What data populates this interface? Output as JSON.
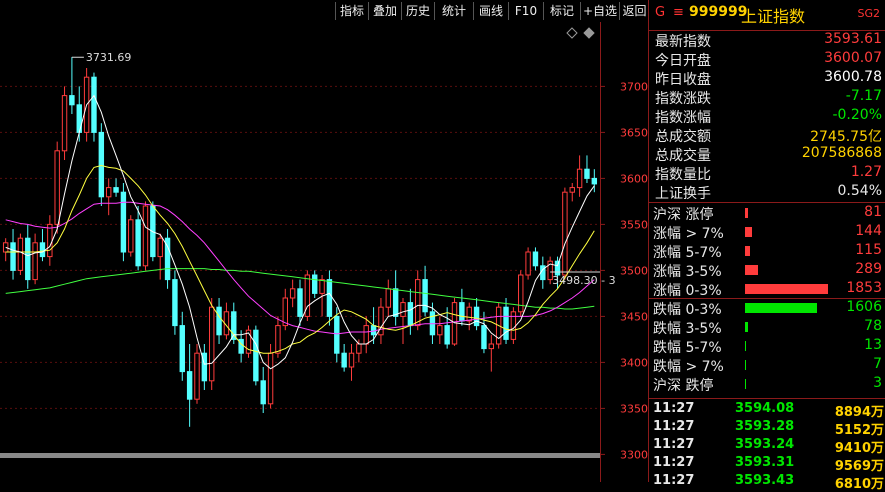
{
  "toolbar": {
    "buttons": [
      "指标",
      "叠加",
      "历史",
      "统计",
      "画线",
      "F10",
      "标记",
      "+自选",
      "返回"
    ]
  },
  "header": {
    "g_label": "G",
    "eq_label": "≡",
    "code": "999999",
    "name": "上证指数",
    "badge": "SG2"
  },
  "quote": [
    {
      "label": "最新指数",
      "value": "3593.61",
      "color": "#ff3c3c"
    },
    {
      "label": "今日开盘",
      "value": "3600.07",
      "color": "#ff3c3c"
    },
    {
      "label": "昨日收盘",
      "value": "3600.78",
      "color": "#ffffff"
    },
    {
      "label": "指数涨跌",
      "value": "-7.17",
      "color": "#00e600"
    },
    {
      "label": "指数涨幅",
      "value": "-0.20%",
      "color": "#00e600"
    },
    {
      "label": "总成交额",
      "value": "2745.75亿",
      "color": "#ffd200"
    },
    {
      "label": "总成交量",
      "value": "207586868",
      "color": "#ffd200"
    },
    {
      "label": "指数量比",
      "value": "1.27",
      "color": "#ff3c3c"
    },
    {
      "label": "上证换手",
      "value": "0.54%",
      "color": "#e8e8e8"
    }
  ],
  "breadth": [
    {
      "label": "沪深 涨停",
      "value": "81",
      "fraction": 0.04,
      "color": "#ff3c3c"
    },
    {
      "label": "涨幅 > 7%",
      "value": "144",
      "fraction": 0.08,
      "color": "#ff3c3c"
    },
    {
      "label": "涨幅 5-7%",
      "value": "115",
      "fraction": 0.06,
      "color": "#ff3c3c"
    },
    {
      "label": "涨幅 3-5%",
      "value": "289",
      "fraction": 0.16,
      "color": "#ff3c3c"
    },
    {
      "label": "涨幅 0-3%",
      "value": "1853",
      "fraction": 1.0,
      "color": "#ff3c3c"
    },
    {
      "label": "跌幅 0-3%",
      "value": "1606",
      "fraction": 0.87,
      "color": "#00e600"
    },
    {
      "label": "跌幅 3-5%",
      "value": "78",
      "fraction": 0.04,
      "color": "#00e600"
    },
    {
      "label": "跌幅 5-7%",
      "value": "13",
      "fraction": 0.01,
      "color": "#00e600"
    },
    {
      "label": "跌幅 > 7%",
      "value": "7",
      "fraction": 0.005,
      "color": "#00e600"
    },
    {
      "label": "沪深 跌停",
      "value": "3",
      "fraction": 0.003,
      "color": "#00e600"
    }
  ],
  "ticks": [
    {
      "time": "11:27",
      "price": "3594.08",
      "vol": "8894万"
    },
    {
      "time": "11:27",
      "price": "3593.28",
      "vol": "5152万"
    },
    {
      "time": "11:27",
      "price": "3593.24",
      "vol": "9410万"
    },
    {
      "time": "11:27",
      "price": "3593.31",
      "vol": "9569万"
    },
    {
      "time": "11:27",
      "price": "3593.43",
      "vol": "6810万"
    }
  ],
  "chart_data": {
    "type": "candlestick",
    "ylim": [
      3270,
      3770
    ],
    "y_ticks": [
      3300,
      3350,
      3400,
      3450,
      3500,
      3550,
      3600,
      3650,
      3700
    ],
    "y_tick_labels": [
      "3300",
      "3350",
      "3400",
      "3450",
      "3500",
      "3550",
      "3600",
      "3650",
      "3700"
    ],
    "max_label": "3731.69",
    "max_value": 3731.69,
    "last_label": "3498.30 - 3",
    "last_value": 3498.3,
    "colors": {
      "up": "#ff3c3c",
      "down": "#54ffff",
      "ma5": "#ffffff",
      "ma10": "#ffff40",
      "ma20": "#ff40ff",
      "ma60": "#40ff40"
    },
    "candles": [
      [
        3520,
        3535,
        3510,
        3530
      ],
      [
        3530,
        3545,
        3490,
        3500
      ],
      [
        3500,
        3540,
        3495,
        3535
      ],
      [
        3535,
        3550,
        3480,
        3490
      ],
      [
        3490,
        3540,
        3485,
        3530
      ],
      [
        3530,
        3545,
        3510,
        3515
      ],
      [
        3515,
        3560,
        3505,
        3550
      ],
      [
        3550,
        3640,
        3540,
        3630
      ],
      [
        3630,
        3700,
        3620,
        3690
      ],
      [
        3690,
        3732,
        3670,
        3680
      ],
      [
        3680,
        3700,
        3640,
        3650
      ],
      [
        3650,
        3720,
        3640,
        3710
      ],
      [
        3710,
        3715,
        3640,
        3650
      ],
      [
        3650,
        3660,
        3570,
        3580
      ],
      [
        3580,
        3600,
        3560,
        3590
      ],
      [
        3590,
        3600,
        3580,
        3585
      ],
      [
        3585,
        3595,
        3510,
        3520
      ],
      [
        3520,
        3560,
        3515,
        3555
      ],
      [
        3555,
        3570,
        3500,
        3505
      ],
      [
        3505,
        3575,
        3500,
        3570
      ],
      [
        3570,
        3575,
        3510,
        3515
      ],
      [
        3515,
        3540,
        3490,
        3535
      ],
      [
        3535,
        3545,
        3480,
        3490
      ],
      [
        3490,
        3500,
        3430,
        3440
      ],
      [
        3440,
        3455,
        3380,
        3390
      ],
      [
        3390,
        3420,
        3330,
        3360
      ],
      [
        3360,
        3420,
        3355,
        3410
      ],
      [
        3410,
        3420,
        3370,
        3380
      ],
      [
        3380,
        3470,
        3370,
        3460
      ],
      [
        3460,
        3470,
        3420,
        3430
      ],
      [
        3430,
        3465,
        3425,
        3455
      ],
      [
        3455,
        3465,
        3420,
        3425
      ],
      [
        3425,
        3435,
        3400,
        3410
      ],
      [
        3410,
        3440,
        3405,
        3435
      ],
      [
        3435,
        3440,
        3375,
        3380
      ],
      [
        3380,
        3395,
        3345,
        3355
      ],
      [
        3355,
        3420,
        3350,
        3410
      ],
      [
        3410,
        3450,
        3405,
        3440
      ],
      [
        3440,
        3480,
        3435,
        3470
      ],
      [
        3470,
        3490,
        3460,
        3480
      ],
      [
        3480,
        3490,
        3440,
        3450
      ],
      [
        3450,
        3500,
        3445,
        3495
      ],
      [
        3495,
        3500,
        3470,
        3475
      ],
      [
        3475,
        3495,
        3450,
        3490
      ],
      [
        3490,
        3500,
        3440,
        3450
      ],
      [
        3450,
        3460,
        3400,
        3410
      ],
      [
        3410,
        3420,
        3390,
        3395
      ],
      [
        3395,
        3420,
        3380,
        3410
      ],
      [
        3410,
        3425,
        3400,
        3420
      ],
      [
        3420,
        3450,
        3410,
        3440
      ],
      [
        3440,
        3460,
        3420,
        3430
      ],
      [
        3430,
        3470,
        3420,
        3460
      ],
      [
        3460,
        3490,
        3450,
        3480
      ],
      [
        3480,
        3500,
        3440,
        3450
      ],
      [
        3450,
        3470,
        3420,
        3465
      ],
      [
        3465,
        3480,
        3430,
        3440
      ],
      [
        3440,
        3500,
        3435,
        3490
      ],
      [
        3490,
        3505,
        3450,
        3455
      ],
      [
        3455,
        3465,
        3420,
        3430
      ],
      [
        3430,
        3450,
        3420,
        3440
      ],
      [
        3440,
        3460,
        3415,
        3420
      ],
      [
        3420,
        3470,
        3418,
        3465
      ],
      [
        3465,
        3480,
        3440,
        3445
      ],
      [
        3445,
        3465,
        3435,
        3460
      ],
      [
        3460,
        3470,
        3435,
        3440
      ],
      [
        3440,
        3455,
        3410,
        3415
      ],
      [
        3415,
        3430,
        3390,
        3420
      ],
      [
        3420,
        3465,
        3415,
        3460
      ],
      [
        3460,
        3470,
        3420,
        3425
      ],
      [
        3425,
        3460,
        3420,
        3455
      ],
      [
        3455,
        3500,
        3450,
        3495
      ],
      [
        3495,
        3525,
        3490,
        3520
      ],
      [
        3520,
        3525,
        3500,
        3505
      ],
      [
        3505,
        3515,
        3480,
        3490
      ],
      [
        3490,
        3515,
        3485,
        3510
      ],
      [
        3510,
        3515,
        3480,
        3495
      ],
      [
        3495,
        3590,
        3490,
        3585
      ],
      [
        3585,
        3595,
        3575,
        3590
      ],
      [
        3590,
        3625,
        3580,
        3610
      ],
      [
        3610,
        3625,
        3595,
        3600
      ],
      [
        3600,
        3610,
        3585,
        3594
      ]
    ],
    "ma5": [
      3525,
      3522,
      3520,
      3516,
      3519,
      3520,
      3526,
      3545,
      3583,
      3619,
      3650,
      3680,
      3690,
      3672,
      3646,
      3625,
      3603,
      3580,
      3565,
      3547,
      3542,
      3539,
      3526,
      3506,
      3485,
      3460,
      3427,
      3398,
      3399,
      3408,
      3417,
      3430,
      3430,
      3432,
      3420,
      3400,
      3393,
      3398,
      3405,
      3422,
      3443,
      3461,
      3467,
      3472,
      3475,
      3463,
      3444,
      3429,
      3420,
      3420,
      3425,
      3438,
      3450,
      3452,
      3455,
      3457,
      3462,
      3462,
      3459,
      3452,
      3448,
      3443,
      3442,
      3441,
      3445,
      3442,
      3432,
      3426,
      3433,
      3437,
      3446,
      3466,
      3489,
      3501,
      3507,
      3505,
      3529,
      3547,
      3564,
      3581,
      3592
    ],
    "ma10": [
      3520,
      3520,
      3520,
      3520,
      3520,
      3521,
      3522,
      3530,
      3545,
      3565,
      3582,
      3600,
      3612,
      3614,
      3612,
      3611,
      3608,
      3600,
      3592,
      3582,
      3570,
      3560,
      3551,
      3540,
      3526,
      3510,
      3494,
      3478,
      3462,
      3450,
      3440,
      3430,
      3420,
      3414,
      3412,
      3410,
      3410,
      3412,
      3415,
      3420,
      3422,
      3428,
      3432,
      3438,
      3445,
      3452,
      3457,
      3455,
      3451,
      3447,
      3440,
      3438,
      3436,
      3435,
      3437,
      3440,
      3444,
      3448,
      3450,
      3452,
      3454,
      3452,
      3450,
      3449,
      3448,
      3446,
      3444,
      3440,
      3436,
      3435,
      3437,
      3443,
      3452,
      3463,
      3472,
      3480,
      3492,
      3505,
      3518,
      3530,
      3543
    ],
    "ma20": [
      3555,
      3553,
      3551,
      3550,
      3548,
      3547,
      3546,
      3547,
      3551,
      3556,
      3562,
      3567,
      3572,
      3573,
      3573,
      3573,
      3574,
      3574,
      3573,
      3572,
      3571,
      3570,
      3566,
      3560,
      3553,
      3545,
      3538,
      3530,
      3520,
      3510,
      3500,
      3490,
      3481,
      3472,
      3465,
      3458,
      3451,
      3447,
      3443,
      3440,
      3438,
      3436,
      3434,
      3433,
      3432,
      3431,
      3432,
      3433,
      3433,
      3433,
      3434,
      3436,
      3437,
      3438,
      3439,
      3440,
      3441,
      3442,
      3442,
      3442,
      3443,
      3444,
      3445,
      3446,
      3447,
      3448,
      3449,
      3450,
      3450,
      3450,
      3450,
      3450,
      3451,
      3453,
      3456,
      3460,
      3465,
      3470,
      3476,
      3483,
      3490
    ],
    "ma60": [
      3475,
      3476,
      3477,
      3478,
      3479,
      3480,
      3481,
      3483,
      3485,
      3487,
      3489,
      3491,
      3492,
      3493,
      3494,
      3495,
      3496,
      3497,
      3498,
      3499,
      3500,
      3501,
      3502,
      3502,
      3502,
      3502,
      3502,
      3502,
      3501,
      3501,
      3500,
      3500,
      3499,
      3499,
      3498,
      3497,
      3496,
      3495,
      3494,
      3493,
      3492,
      3491,
      3490,
      3489,
      3488,
      3487,
      3486,
      3485,
      3484,
      3483,
      3482,
      3481,
      3480,
      3479,
      3478,
      3477,
      3476,
      3475,
      3474,
      3473,
      3472,
      3471,
      3470,
      3469,
      3468,
      3467,
      3466,
      3465,
      3464,
      3463,
      3462,
      3461,
      3460,
      3460,
      3459,
      3459,
      3458,
      3458,
      3459,
      3460,
      3461
    ]
  }
}
